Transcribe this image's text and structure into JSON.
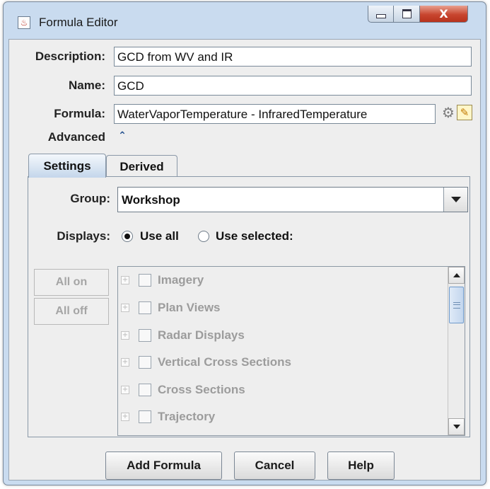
{
  "window": {
    "title": "Formula Editor",
    "icon": "java-cup-icon",
    "controls": [
      "minimize-icon",
      "maximize-icon",
      "close-icon"
    ],
    "close_glyph": "X"
  },
  "form": {
    "description_label": "Description:",
    "description_value": "GCD from WV and IR",
    "name_label": "Name:",
    "name_value": "GCD",
    "formula_label": "Formula:",
    "formula_value": "WaterVaporTemperature - InfraredTemperature",
    "advanced_label": "Advanced",
    "advanced_glyph": "⌃",
    "formula_icons": [
      "gear-icon",
      "edit-icon"
    ]
  },
  "tabs": [
    {
      "label": "Settings",
      "active": true
    },
    {
      "label": "Derived",
      "active": false
    }
  ],
  "settings": {
    "group_label": "Group:",
    "group_value": "Workshop",
    "displays_label": "Displays:",
    "use_all_label": "Use all",
    "use_selected_label": "Use selected:",
    "selected_option": "use_all",
    "all_on_label": "All on",
    "all_off_label": "All off",
    "display_items": [
      {
        "label": "Imagery",
        "checked": false
      },
      {
        "label": "Plan Views",
        "checked": false
      },
      {
        "label": "Radar Displays",
        "checked": false
      },
      {
        "label": "Vertical Cross Sections",
        "checked": false
      },
      {
        "label": "Cross Sections",
        "checked": false
      },
      {
        "label": "Trajectory",
        "checked": false
      }
    ],
    "expander_glyph": "+"
  },
  "buttons": {
    "add_formula": "Add Formula",
    "cancel": "Cancel",
    "help": "Help"
  },
  "colors": {
    "window_frame": "#c9dbef",
    "close_button": "#c8462f",
    "panel_background": "#eeeeee",
    "disabled_text": "#9c9c9c"
  }
}
